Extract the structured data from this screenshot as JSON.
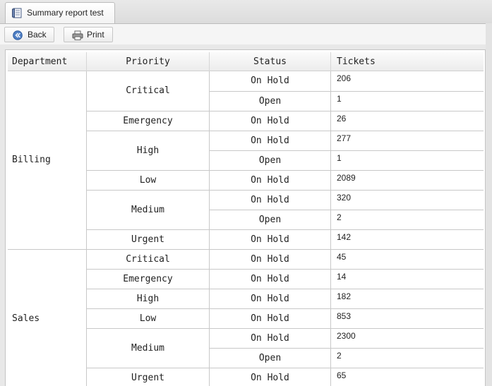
{
  "tab": {
    "title": "Summary report test",
    "icon": "report-icon"
  },
  "toolbar": {
    "back_label": "Back",
    "back_icon": "back-arrow-icon",
    "print_label": "Print",
    "print_icon": "printer-icon"
  },
  "table": {
    "headers": {
      "department": "Department",
      "priority": "Priority",
      "status": "Status",
      "tickets": "Tickets"
    },
    "groups": [
      {
        "department": "Billing",
        "priorities": [
          {
            "priority": "Critical",
            "rows": [
              {
                "status": "On Hold",
                "tickets": "206"
              },
              {
                "status": "Open",
                "tickets": "1"
              }
            ]
          },
          {
            "priority": "Emergency",
            "rows": [
              {
                "status": "On Hold",
                "tickets": "26"
              }
            ]
          },
          {
            "priority": "High",
            "rows": [
              {
                "status": "On Hold",
                "tickets": "277"
              },
              {
                "status": "Open",
                "tickets": "1"
              }
            ]
          },
          {
            "priority": "Low",
            "rows": [
              {
                "status": "On Hold",
                "tickets": "2089"
              }
            ]
          },
          {
            "priority": "Medium",
            "rows": [
              {
                "status": "On Hold",
                "tickets": "320"
              },
              {
                "status": "Open",
                "tickets": "2"
              }
            ]
          },
          {
            "priority": "Urgent",
            "rows": [
              {
                "status": "On Hold",
                "tickets": "142"
              }
            ]
          }
        ]
      },
      {
        "department": "Sales",
        "priorities": [
          {
            "priority": "Critical",
            "rows": [
              {
                "status": "On Hold",
                "tickets": "45"
              }
            ]
          },
          {
            "priority": "Emergency",
            "rows": [
              {
                "status": "On Hold",
                "tickets": "14"
              }
            ]
          },
          {
            "priority": "High",
            "rows": [
              {
                "status": "On Hold",
                "tickets": "182"
              }
            ]
          },
          {
            "priority": "Low",
            "rows": [
              {
                "status": "On Hold",
                "tickets": "853"
              }
            ]
          },
          {
            "priority": "Medium",
            "rows": [
              {
                "status": "On Hold",
                "tickets": "2300"
              },
              {
                "status": "Open",
                "tickets": "2"
              }
            ]
          },
          {
            "priority": "Urgent",
            "rows": [
              {
                "status": "On Hold",
                "tickets": "65"
              }
            ]
          }
        ]
      }
    ]
  }
}
